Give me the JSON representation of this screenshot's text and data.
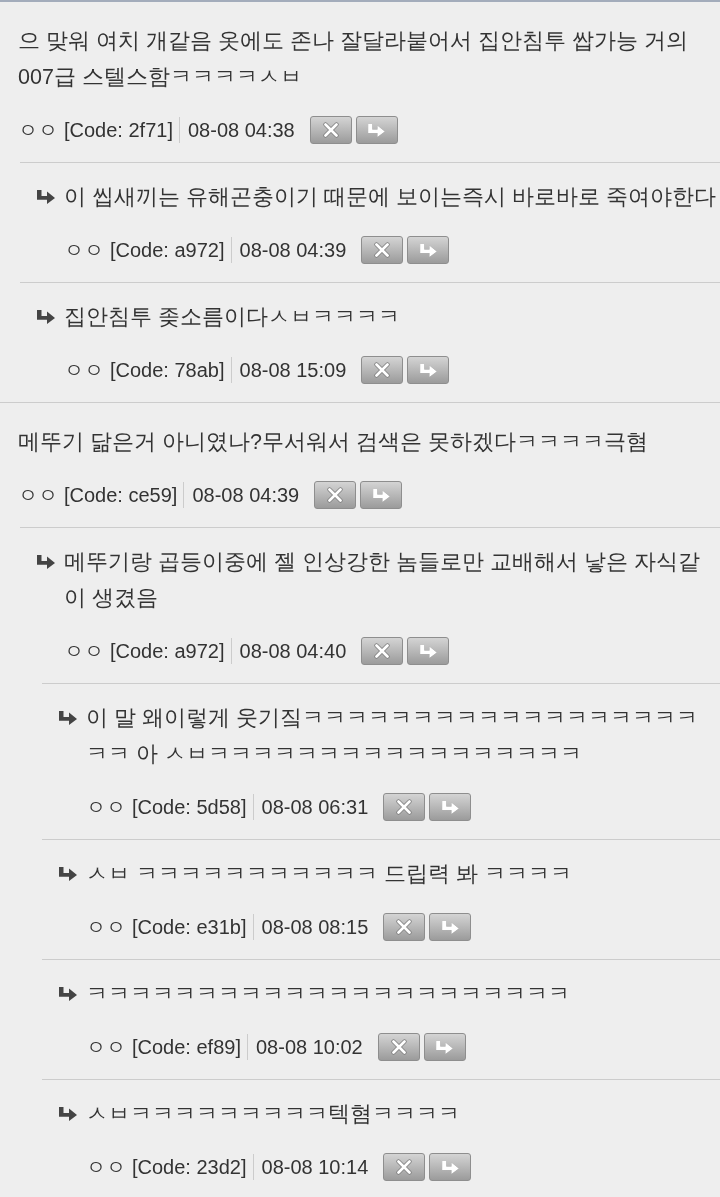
{
  "comments": [
    {
      "text": "으 맞워 여치 개같음 옷에도 존나 잘달라붙어서 집안침투 쌉가능 거의 007급 스텔스함ㅋㅋㅋㅋㅅㅂ",
      "nickname": "ㅇㅇ",
      "code": "[Code: 2f71]",
      "date": "08-08 04:38",
      "children": [
        {
          "text": "이 씹새끼는 유해곤충이기 때문에 보이는즉시 바로바로 죽여야한다",
          "nickname": "ㅇㅇ",
          "code": "[Code: a972]",
          "date": "08-08 04:39"
        },
        {
          "text": "집안침투 좆소름이다ㅅㅂㅋㅋㅋㅋ",
          "nickname": "ㅇㅇ",
          "code": "[Code: 78ab]",
          "date": "08-08 15:09"
        }
      ]
    },
    {
      "text": "메뚜기 닮은거 아니였나?무서워서 검색은 못하겠다ㅋㅋㅋㅋ극혐",
      "nickname": "ㅇㅇ",
      "code": "[Code: ce59]",
      "date": "08-08 04:39",
      "children": [
        {
          "text": "메뚜기랑 곱등이중에 젤 인상강한 놈들로만 교배해서 낳은 자식같이 생겼음",
          "nickname": "ㅇㅇ",
          "code": "[Code: a972]",
          "date": "08-08 04:40",
          "children": [
            {
              "text": "이 말 왜이렇게 웃기짘ㅋㅋㅋㅋㅋㅋㅋㅋㅋㅋㅋㅋㅋㅋㅋㅋㅋㅋㅋㅋ 아 ㅅㅂㅋㅋㅋㅋㅋㅋㅋㅋㅋㅋㅋㅋㅋㅋㅋㅋㅋ",
              "nickname": "ㅇㅇ",
              "code": "[Code: 5d58]",
              "date": "08-08 06:31"
            },
            {
              "text": "ㅅㅂ ㅋㅋㅋㅋㅋㅋㅋㅋㅋㅋㅋ 드립력 봐 ㅋㅋㅋㅋ",
              "nickname": "ㅇㅇ",
              "code": "[Code: e31b]",
              "date": "08-08 08:15"
            },
            {
              "text": "ㅋㅋㅋㅋㅋㅋㅋㅋㅋㅋㅋㅋㅋㅋㅋㅋㅋㅋㅋㅋㅋㅋ",
              "nickname": "ㅇㅇ",
              "code": "[Code: ef89]",
              "date": "08-08 10:02"
            },
            {
              "text": "ㅅㅂㅋㅋㅋㅋㅋㅋㅋㅋㅋ텍혐ㅋㅋㅋㅋ",
              "nickname": "ㅇㅇ",
              "code": "[Code: 23d2]",
              "date": "08-08 10:14"
            }
          ]
        }
      ]
    }
  ]
}
